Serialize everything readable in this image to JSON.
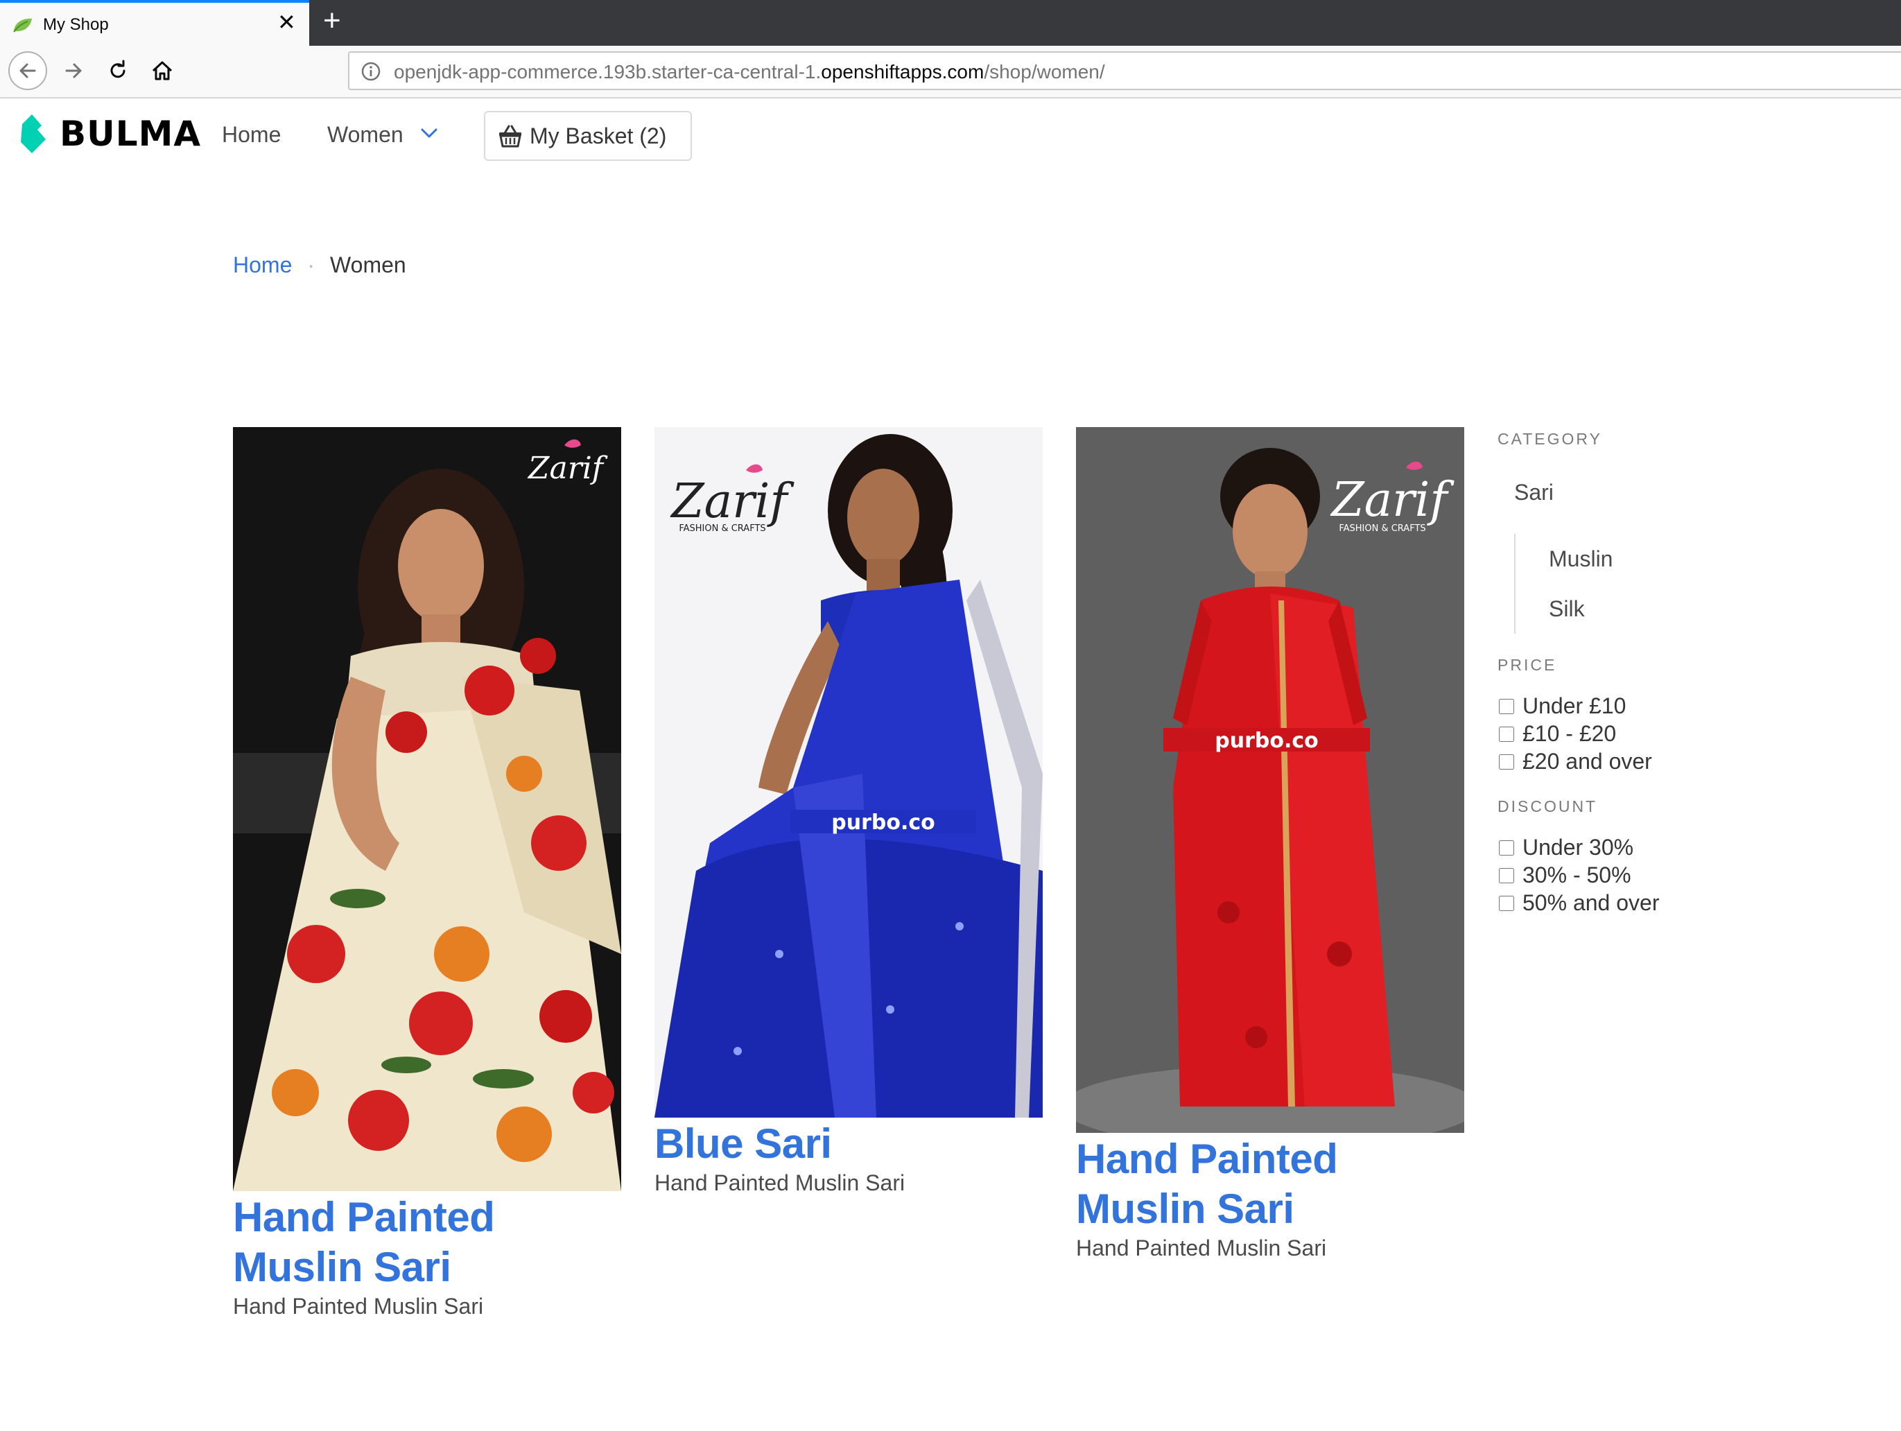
{
  "browser": {
    "tab_title": "My Shop",
    "url_prefix": "openjdk-app-commerce.193b.starter-ca-central-1.",
    "url_host": "openshiftapps.com",
    "url_path": "/shop/women/"
  },
  "navbar": {
    "brand": "BULMA",
    "brand_color": "#00d1b2",
    "items": [
      "Home",
      "Women"
    ],
    "basket_label": "My Basket (2)"
  },
  "breadcrumb": {
    "home": "Home",
    "separator": "·",
    "current": "Women"
  },
  "products": [
    {
      "title": "Hand Painted Muslin Sari",
      "subtitle": "Hand Painted Muslin Sari",
      "image": "cream floral painted sari photo"
    },
    {
      "title": "Blue Sari",
      "subtitle": "Hand Painted Muslin Sari",
      "image": "blue embroidered sari photo"
    },
    {
      "title": "Hand Painted Muslin Sari",
      "subtitle": "Hand Painted Muslin Sari",
      "image": "red embroidered sari photo"
    }
  ],
  "product_image_marks": {
    "logo_word": "Zarif",
    "logo_tagline": "FASHION & CRAFTS",
    "watermark_site": "purbo.co"
  },
  "sidebar": {
    "category_heading": "CATEGORY",
    "category": "Sari",
    "subcategories": [
      "Muslin",
      "Silk"
    ],
    "price_heading": "PRICE",
    "price_options": [
      "Under £10",
      "£10 - £20",
      "£20 and over"
    ],
    "discount_heading": "DISCOUNT",
    "discount_options": [
      "Under 30%",
      "30% - 50%",
      "50% and over"
    ]
  },
  "colors": {
    "link": "#3273dc",
    "text": "#363636"
  }
}
